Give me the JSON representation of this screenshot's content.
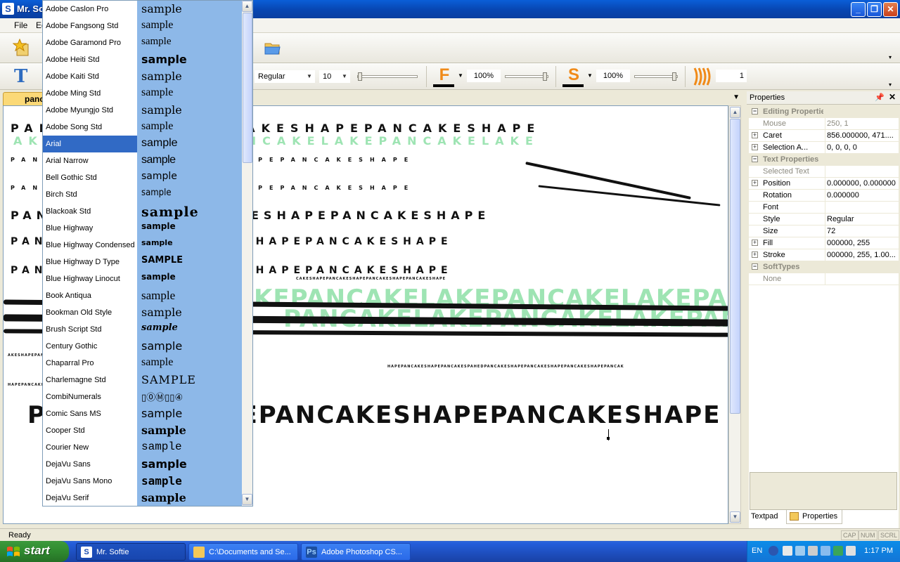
{
  "window": {
    "title": "Mr. So",
    "app_icon": "S"
  },
  "menu": {
    "items": [
      "File",
      "Ed"
    ]
  },
  "toolbar": {
    "style_value": "Regular",
    "size_value": "10",
    "fill_letter": "F",
    "fill_opacity": "100%",
    "stroke_letter": "S",
    "stroke_opacity": "100%",
    "count_value": "1"
  },
  "document": {
    "tab_label": "panc"
  },
  "canvas": {
    "lines": [
      "PANCAKESHAPEPANCAKESHAPEPANCAKESHAPE",
      "AKEPANCAKELAKEPANCAKELAKEPANCAKELAKE",
      "PANCAKESHAPEPANCAKESHAPEPANCAKESHAPE",
      "PANCAKESHAPEPANCAKESHAPEPANCAKESHAPE",
      "KEPANCAKELAKEPANCAKELAKEPANCAKELAKE",
      "PANCAKELAKEPANCAKELAKEPANCAKELAKEPA",
      "HAPEPANCAKESHAPEPANCAKESPAHEDPANCAKESHAPEPANCAKESHAPEPANCAKESHAPEPANCAK",
      "CAKESHAPEPANCAKESHAPEPANCAKESHAPEPANCAKESHAPE",
      "AKESHAPEPANCAKESHAPEPANCAKESHAPEPANCAKESHAPE"
    ]
  },
  "properties": {
    "header": "Properties",
    "rows": [
      {
        "type": "cat",
        "name": "Editing Properties"
      },
      {
        "type": "prop",
        "name": "Mouse",
        "value": "250, 1",
        "disabled": true
      },
      {
        "type": "prop",
        "name": "Caret",
        "value": "856.000000, 471....",
        "expand": true
      },
      {
        "type": "prop",
        "name": "Selection A...",
        "value": "0, 0, 0, 0",
        "expand": true
      },
      {
        "type": "cat",
        "name": "Text Properties"
      },
      {
        "type": "prop",
        "name": "Selected Text",
        "value": "",
        "disabled": true
      },
      {
        "type": "prop",
        "name": "Position",
        "value": "0.000000, 0.000000",
        "expand": true
      },
      {
        "type": "prop",
        "name": "Rotation",
        "value": "0.000000"
      },
      {
        "type": "prop",
        "name": "Font",
        "value": ""
      },
      {
        "type": "prop",
        "name": "Style",
        "value": "Regular"
      },
      {
        "type": "prop",
        "name": "Size",
        "value": "72"
      },
      {
        "type": "prop",
        "name": "Fill",
        "value": "000000, 255",
        "expand": true
      },
      {
        "type": "prop",
        "name": "Stroke",
        "value": "000000, 255, 1.00...",
        "expand": true
      },
      {
        "type": "cat",
        "name": "SoftTypes"
      },
      {
        "type": "prop",
        "name": "None",
        "value": "",
        "disabled": true
      }
    ],
    "tabs": [
      "Textpad",
      "Properties"
    ]
  },
  "status": {
    "text": "Ready",
    "indicators": [
      "CAP",
      "NUM",
      "SCRL"
    ]
  },
  "fonts": [
    {
      "name": "Adobe Caslon Pro",
      "sample": "sample"
    },
    {
      "name": "Adobe Fangsong Std",
      "sample": "sample"
    },
    {
      "name": "Adobe Garamond Pro",
      "sample": "sample"
    },
    {
      "name": "Adobe Heiti Std",
      "sample": "sample"
    },
    {
      "name": "Adobe Kaiti Std",
      "sample": "sample"
    },
    {
      "name": "Adobe Ming Std",
      "sample": "sample"
    },
    {
      "name": "Adobe Myungjo Std",
      "sample": "sample"
    },
    {
      "name": "Adobe Song Std",
      "sample": "sample"
    },
    {
      "name": "Arial",
      "sample": "sample",
      "selected": true
    },
    {
      "name": "Arial Narrow",
      "sample": "sample"
    },
    {
      "name": "Bell Gothic Std",
      "sample": "sample"
    },
    {
      "name": "Birch Std",
      "sample": "sample"
    },
    {
      "name": "Blackoak Std",
      "sample": "sample"
    },
    {
      "name": "Blue Highway",
      "sample": "sample"
    },
    {
      "name": "Blue Highway Condensed",
      "sample": "sample"
    },
    {
      "name": "Blue Highway D Type",
      "sample": "SAMPLE"
    },
    {
      "name": "Blue Highway Linocut",
      "sample": "sample"
    },
    {
      "name": "Book Antiqua",
      "sample": "sample"
    },
    {
      "name": "Bookman Old Style",
      "sample": "sample"
    },
    {
      "name": "Brush Script Std",
      "sample": "sample"
    },
    {
      "name": "Century Gothic",
      "sample": "sample"
    },
    {
      "name": "Chaparral Pro",
      "sample": "sample"
    },
    {
      "name": "Charlemagne Std",
      "sample": "SAMPLE"
    },
    {
      "name": "CombiNumerals",
      "sample": "▯⓪Ⓜ▯▯④"
    },
    {
      "name": "Comic Sans MS",
      "sample": "sample"
    },
    {
      "name": "Cooper Std",
      "sample": "sample"
    },
    {
      "name": "Courier New",
      "sample": "sample"
    },
    {
      "name": "DejaVu Sans",
      "sample": "sample"
    },
    {
      "name": "DejaVu Sans Mono",
      "sample": "sample"
    },
    {
      "name": "DejaVu Serif",
      "sample": "sample"
    }
  ],
  "taskbar": {
    "start_label": "start",
    "tasks": [
      {
        "label": "Mr. Softie",
        "active": true
      },
      {
        "label": "C:\\Documents and Se..."
      },
      {
        "label": "Adobe Photoshop CS..."
      }
    ],
    "lang": "EN",
    "clock": "1:17 PM"
  },
  "colors": {
    "accent": "#316ac5",
    "tab": "#fbd977",
    "sample_bg": "#8db8e8",
    "green_text": "#9ee4b3"
  }
}
